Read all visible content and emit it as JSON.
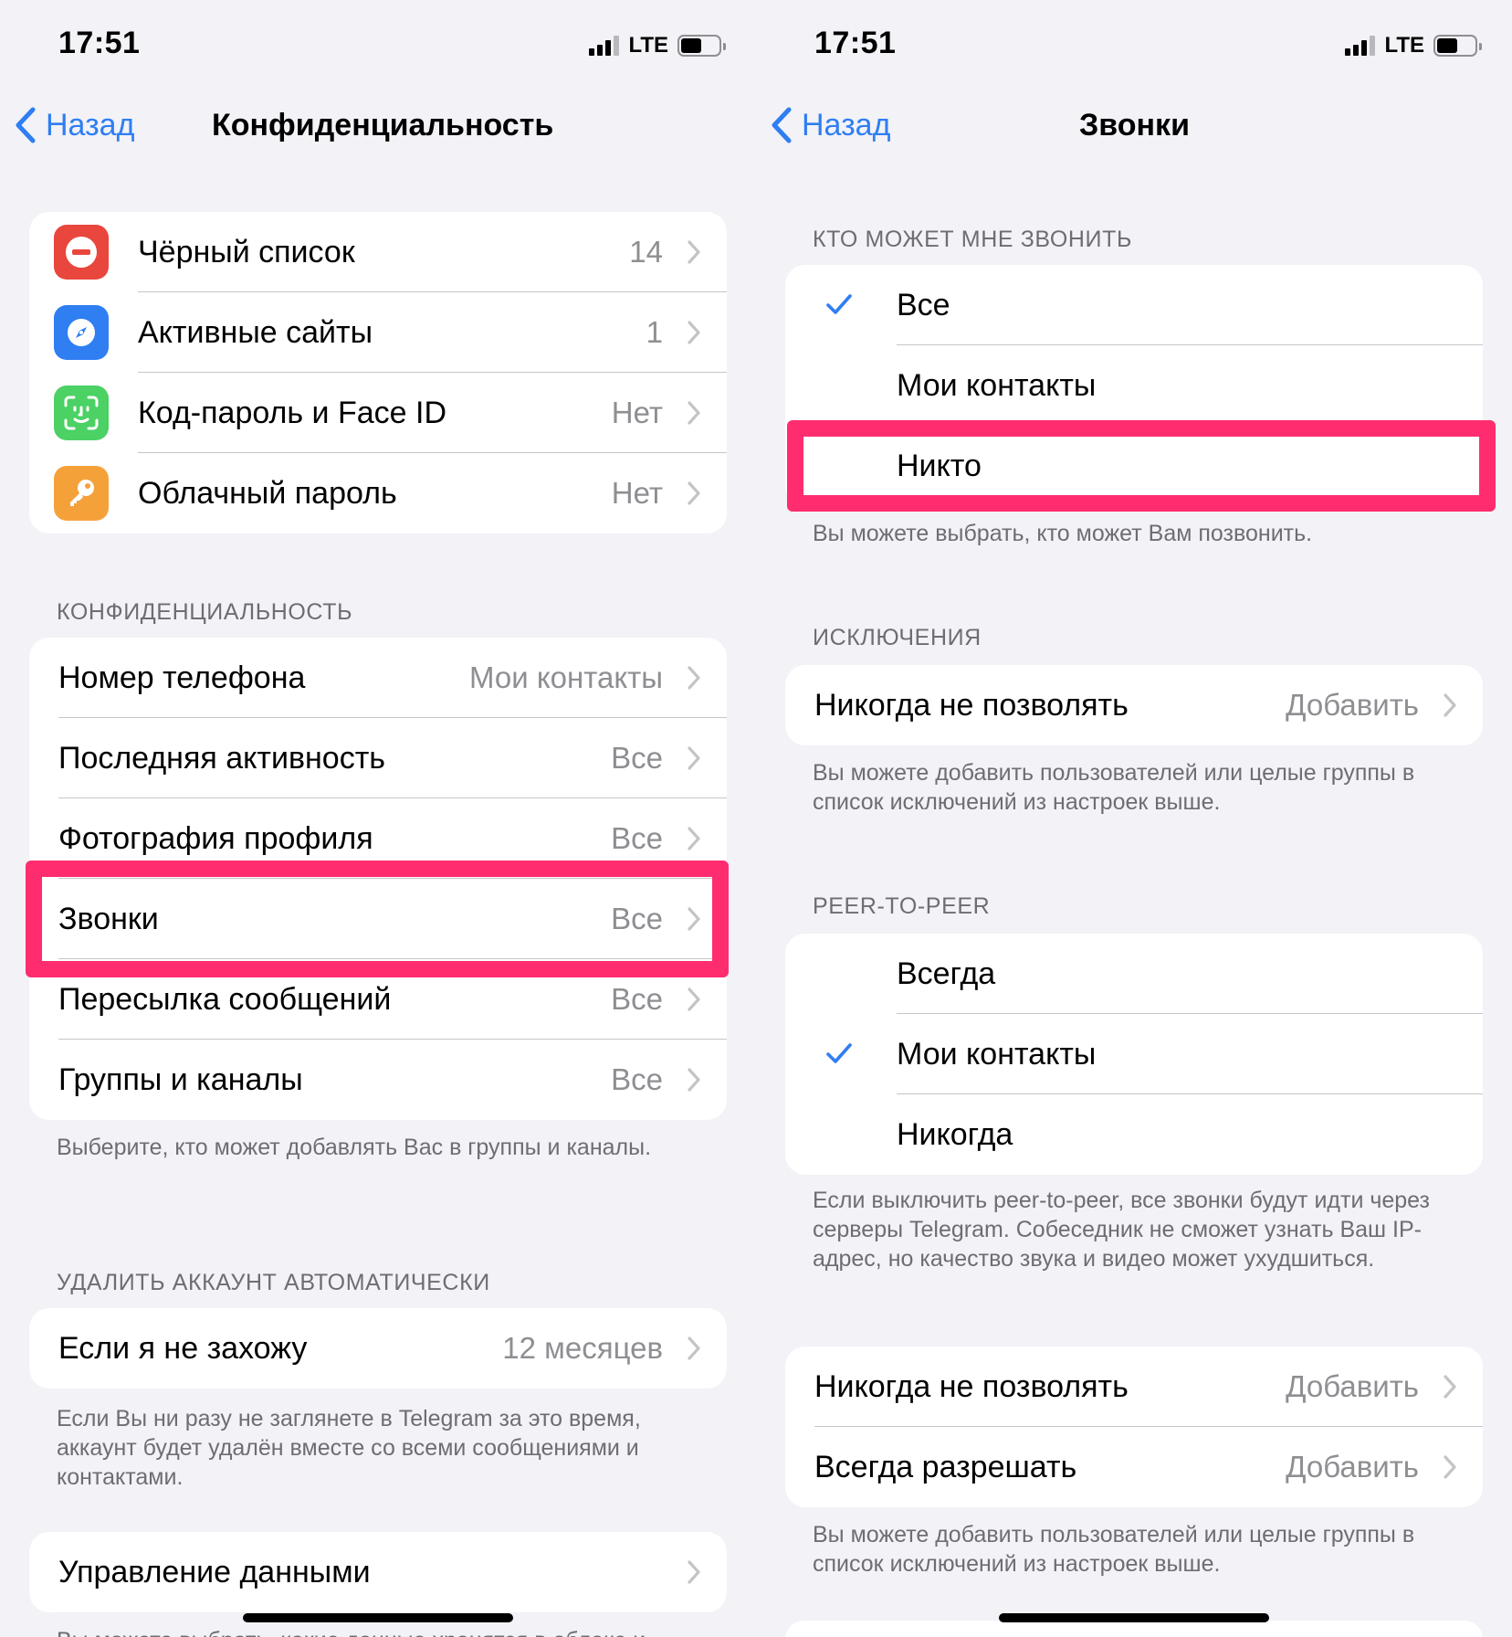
{
  "colors": {
    "accent": "#2f7ef2",
    "highlight": "#ff2d6f",
    "background": "#f2f2f7",
    "secondary_text": "#8e8e93"
  },
  "left": {
    "status": {
      "time": "17:51",
      "network": "LTE"
    },
    "nav": {
      "back": "Назад",
      "title": "Конфиденциальность"
    },
    "security_group": [
      {
        "label": "Чёрный список",
        "value": "14",
        "icon": "blocked-icon",
        "icon_color": "#e9463d"
      },
      {
        "label": "Активные сайты",
        "value": "1",
        "icon": "compass-icon",
        "icon_color": "#2f7ef2"
      },
      {
        "label": "Код-пароль и Face ID",
        "value": "Нет",
        "icon": "face-id-icon",
        "icon_color": "#4cd164"
      },
      {
        "label": "Облачный пароль",
        "value": "Нет",
        "icon": "key-icon",
        "icon_color": "#f5a13a"
      }
    ],
    "privacy_header": "КОНФИДЕНЦИАЛЬНОСТЬ",
    "privacy_group": [
      {
        "label": "Номер телефона",
        "value": "Мои контакты"
      },
      {
        "label": "Последняя активность",
        "value": "Все"
      },
      {
        "label": "Фотография профиля",
        "value": "Все"
      },
      {
        "label": "Звонки",
        "value": "Все"
      },
      {
        "label": "Пересылка сообщений",
        "value": "Все"
      },
      {
        "label": "Группы и каналы",
        "value": "Все"
      }
    ],
    "privacy_footer": "Выберите, кто может добавлять Вас в группы и каналы.",
    "delete_header": "УДАЛИТЬ АККАУНТ АВТОМАТИЧЕСКИ",
    "delete_row": {
      "label": "Если я не захожу",
      "value": "12 месяцев"
    },
    "delete_footer": "Если Вы ни разу не заглянете в Telegram за это время, аккаунт будет удалён вместе со всеми сообщениями и контактами.",
    "data_row": {
      "label": "Управление данными"
    },
    "data_footer_partial": "Вы можете выбрать, какие данные хранятся в облаке и"
  },
  "right": {
    "status": {
      "time": "17:51",
      "network": "LTE"
    },
    "nav": {
      "back": "Назад",
      "title": "Звонки"
    },
    "who_header": "КТО МОЖЕТ МНЕ ЗВОНИТЬ",
    "who_options": [
      {
        "label": "Все",
        "checked": true
      },
      {
        "label": "Мои контакты",
        "checked": false
      },
      {
        "label": "Никто",
        "checked": false
      }
    ],
    "who_footer": "Вы можете выбрать, кто может Вам позвонить.",
    "exceptions_header": "ИСКЛЮЧЕНИЯ",
    "exceptions_row": {
      "label": "Никогда не позволять",
      "value": "Добавить"
    },
    "exceptions_footer": "Вы можете добавить пользователей или целые группы в список исключений из настроек выше.",
    "p2p_header": "PEER-TO-PEER",
    "p2p_options": [
      {
        "label": "Всегда",
        "checked": false
      },
      {
        "label": "Мои контакты",
        "checked": true
      },
      {
        "label": "Никогда",
        "checked": false
      }
    ],
    "p2p_footer": "Если выключить peer-to-peer, все звонки будут идти через серверы Telegram. Собеседник не сможет узнать Ваш IP-адрес, но качество звука и видео может ухудшиться.",
    "p2p_exceptions": [
      {
        "label": "Никогда не позволять",
        "value": "Добавить"
      },
      {
        "label": "Всегда разрешать",
        "value": "Добавить"
      }
    ],
    "p2p_exceptions_footer": "Вы можете добавить пользователей или целые группы в список исключений из настроек выше."
  }
}
